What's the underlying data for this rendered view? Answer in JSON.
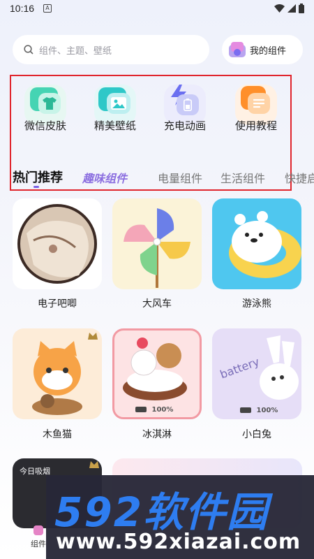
{
  "status_bar": {
    "time": "10:16",
    "notif_glyph": "A"
  },
  "search": {
    "placeholder": "组件、主题、壁纸"
  },
  "my_widgets": {
    "label": "我的组件"
  },
  "categories": [
    {
      "label": "微信皮肤",
      "icon": "tshirt-icon",
      "color": "#4fd1b8"
    },
    {
      "label": "精美壁纸",
      "icon": "picture-icon",
      "color": "#34c6c4"
    },
    {
      "label": "充电动画",
      "icon": "battery-bolt-icon",
      "color": "#6b6ff0"
    },
    {
      "label": "使用教程",
      "icon": "doc-icon",
      "color": "#ff9d3a"
    }
  ],
  "tabs": [
    {
      "label": "热门推荐",
      "active": true
    },
    {
      "label": "趣味组件"
    },
    {
      "label": "电量组件"
    },
    {
      "label": "生活组件"
    },
    {
      "label": "快捷启"
    }
  ],
  "widgets_row1": [
    {
      "label": "电子吧唧"
    },
    {
      "label": "大风车"
    },
    {
      "label": "游泳熊"
    }
  ],
  "widgets_row2": [
    {
      "label": "木鱼猫",
      "badge": false
    },
    {
      "label": "冰淇淋",
      "battery_text": "100%"
    },
    {
      "label": "小白兔",
      "battery_text": "100%",
      "art_text": "battery"
    }
  ],
  "widgets_row3": [
    {
      "label": "今日吸烟"
    }
  ],
  "bottom_nav": {
    "label": "组件"
  },
  "watermark": {
    "big": "592软件园",
    "small": "www.592xiazai.com"
  }
}
